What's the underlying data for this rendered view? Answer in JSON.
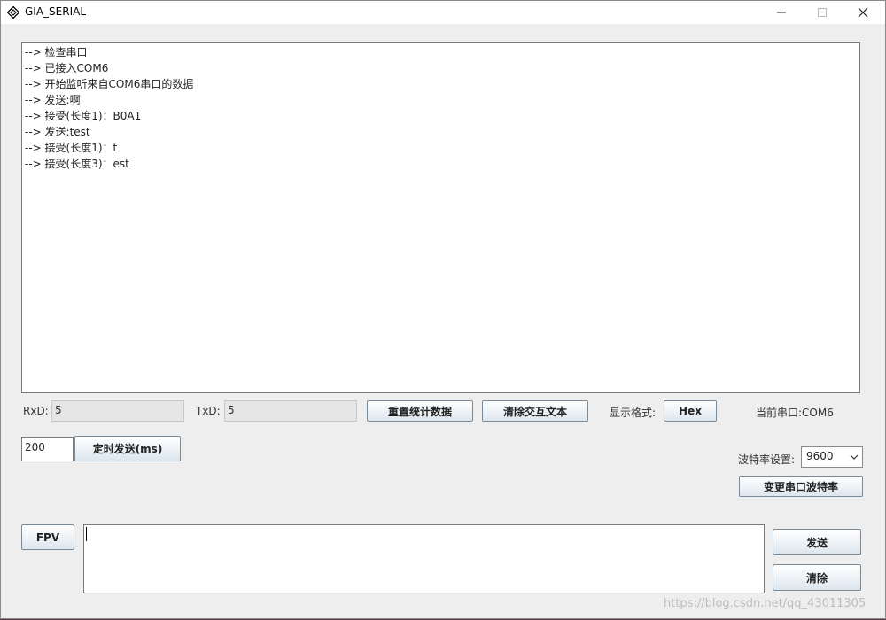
{
  "window": {
    "title": "GIA_SERIAL"
  },
  "log": {
    "lines": [
      "--> 检查串口",
      "--> 已接入COM6",
      "--> 开始监听来自COM6串口的数据",
      "--> 发送:啊",
      "--> 接受(长度1)：B0A1",
      "--> 发送:test",
      "--> 接受(长度1)：t",
      "--> 接受(长度3)：est"
    ]
  },
  "stats": {
    "rxd_label": "RxD:",
    "rxd_value": "5",
    "txd_label": "TxD:",
    "txd_value": "5"
  },
  "buttons": {
    "reset_stats": "重置统计数据",
    "clear_text": "清除交互文本",
    "hex": "Hex",
    "timed_send": "定时发送(ms)",
    "change_baud": "变更串口波特率",
    "fpv": "FPV",
    "send": "发送",
    "clear": "清除"
  },
  "display_format_label": "显示格式:",
  "current_port": "当前串口:COM6",
  "timer_ms": "200",
  "baud": {
    "label": "波特率设置:",
    "selected": "9600"
  },
  "send_input": {
    "value": ""
  },
  "watermark": "https://blog.csdn.net/qq_43011305"
}
